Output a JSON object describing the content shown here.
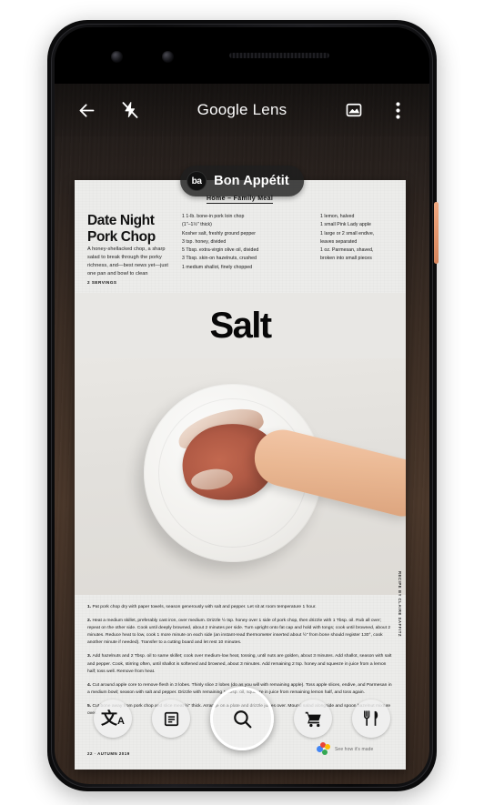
{
  "app": {
    "title_brand": "Google",
    "title_product": "Lens"
  },
  "appbar": {
    "back_label": "back-arrow",
    "flash_label": "flash-off",
    "gallery_label": "photos",
    "overflow_label": "more-options"
  },
  "result_chip": {
    "logo_text": "ba",
    "label": "Bon Appétit"
  },
  "magazine": {
    "kicker": "Home – Family Meal",
    "headline": "Date Night\nPork Chop",
    "dek": "A honey-shellacked chop, a sharp salad to break through the porky richness, and—best news yet—just one pan and bowl to clean",
    "servings": "2 SERVINGS",
    "feature_title": "Salt",
    "ingredients_col1": [
      "1 1-lb. bone-in pork loin chop",
      "   (1\"–1½\" thick)",
      "   Kosher salt, freshly ground pepper",
      "3 tsp. honey, divided",
      "5 Tbsp. extra-virgin olive oil, divided",
      "3 Tbsp. skin-on hazelnuts, crushed",
      "1 medium shallot, finely chopped"
    ],
    "ingredients_col2": [
      "1 lemon, halved",
      "1 small Pink Lady apple",
      "1 large or 2 small endive,",
      "leaves separated",
      "1 oz. Parmesan, shaved,",
      "broken into small pieces"
    ],
    "steps": [
      {
        "num": "1.",
        "text": "Pat pork chop dry with paper towels, season generously with salt and pepper. Let sit at room temperature 1 hour."
      },
      {
        "num": "2.",
        "text": "Heat a medium skillet, preferably cast iron, over medium. Drizzle ½ tsp. honey over 1 side of pork chop, then drizzle with 1 Tbsp. oil. Rub all over; repeat on the other side. Cook until deeply browned, about 2 minutes per side. Turn upright onto fat cap and hold with tongs; cook until browned, about 2 minutes. Reduce heat to low, cook 1 more minute on each side (an instant-read thermometer inserted about ½\" from bone should register 130°, cook another minute if needed). Transfer to a cutting board and let rest 10 minutes."
      },
      {
        "num": "3.",
        "text": "Add hazelnuts and 2 Tbsp. oil to same skillet; cook over medium-low heat, tossing, until nuts are golden, about 3 minutes. Add shallot, season with salt and pepper. Cook, stirring often, until shallot is softened and browned, about 3 minutes. Add remaining 2 tsp. honey and squeeze in juice from a lemon half; toss well. Remove from heat."
      },
      {
        "num": "4.",
        "text": "Cut around apple core to remove flesh in 3 lobes. Thinly slice 2 lobes (do as you will with remaining apple). Toss apple slices, endive, and Parmesan in a medium bowl; season with salt and pepper. Drizzle with remaining 1 Tbsp. oil, squeeze in juice from remaining lemon half, and toss again."
      },
      {
        "num": "5.",
        "text": "Cut bone away from pork chop and slice meat ½\" thick. Arrange on a plate and drizzle juices over. Mound salad alongside and spoon hazelnut mixture over."
      }
    ],
    "folio": "22 · AUTUMN 2019",
    "credit": "RECIPE BY CLAIRE SAFFITZ",
    "google_footer": "See how it's made"
  },
  "toolbar": {
    "translate_label": "Translate",
    "translate_glyph": "文",
    "translate_sub": "A",
    "text_label": "Text",
    "search_label": "Search",
    "shopping_label": "Shopping",
    "dining_label": "Dining"
  },
  "colors": {
    "accent": "#4285f4",
    "wood_dark": "#2a221e",
    "paper": "#ececea",
    "chip_bg": "#1e1e1e",
    "side_button": "#e0936c"
  }
}
